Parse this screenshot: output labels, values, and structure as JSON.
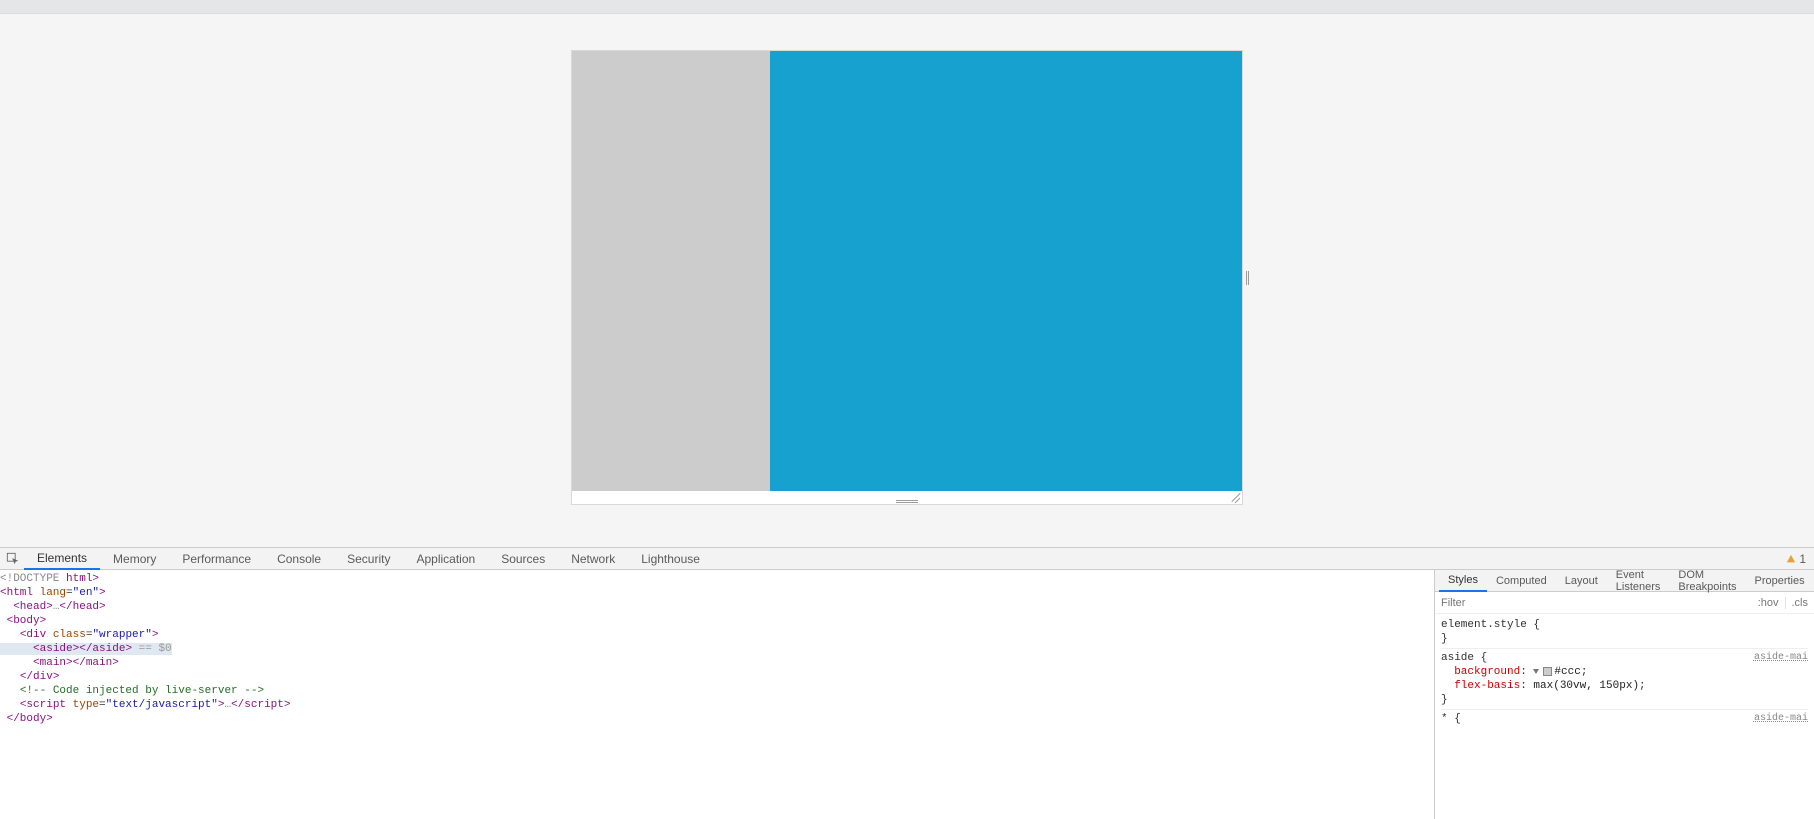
{
  "devtools_tabs": [
    "Elements",
    "Memory",
    "Performance",
    "Console",
    "Security",
    "Application",
    "Sources",
    "Network",
    "Lighthouse"
  ],
  "devtools_active_tab": "Elements",
  "warning_count": "1",
  "styles_tabs": [
    "Styles",
    "Computed",
    "Layout",
    "Event Listeners",
    "DOM Breakpoints",
    "Properties"
  ],
  "styles_active_tab": "Styles",
  "filter_placeholder": "Filter",
  "hov_label": ":hov",
  "cls_label": ".cls",
  "dom": {
    "doctype_l": "<!DOCTYPE ",
    "doctype_r": "html>",
    "html_open_l": "<html ",
    "html_lang_attr": "lang",
    "html_lang_val": "\"en\"",
    "html_open_r": ">",
    "head_open": "<head>",
    "head_ellip": "…",
    "head_close": "</head>",
    "body_open": "<body>",
    "div_open_l": "<div ",
    "div_class_attr": "class",
    "div_class_val": "\"wrapper\"",
    "div_open_r": ">",
    "aside_open": "<aside>",
    "aside_close": "</aside>",
    "eq_sel": " == $0",
    "main_open": "<main>",
    "main_close": "</main>",
    "div_close": "</div>",
    "comment": "<!-- Code injected by live-server -->",
    "script_open_l": "<script ",
    "script_type_attr": "type",
    "script_type_val": "\"text/javascript\"",
    "script_open_r": ">",
    "script_ellip": "…",
    "script_close": "</script>",
    "body_close": "</body>"
  },
  "rules": {
    "element_style_sel": "element.style {",
    "close_brace": "}",
    "aside_sel": "aside {",
    "bg_prop": "background",
    "bg_val": "#ccc",
    "fb_prop": "flex-basis",
    "fb_val": "max(30vw, 150px)",
    "star_sel": "* {",
    "src1": "aside-mai",
    "src2": "aside-mai",
    "colon": ": ",
    "semi": ";"
  }
}
